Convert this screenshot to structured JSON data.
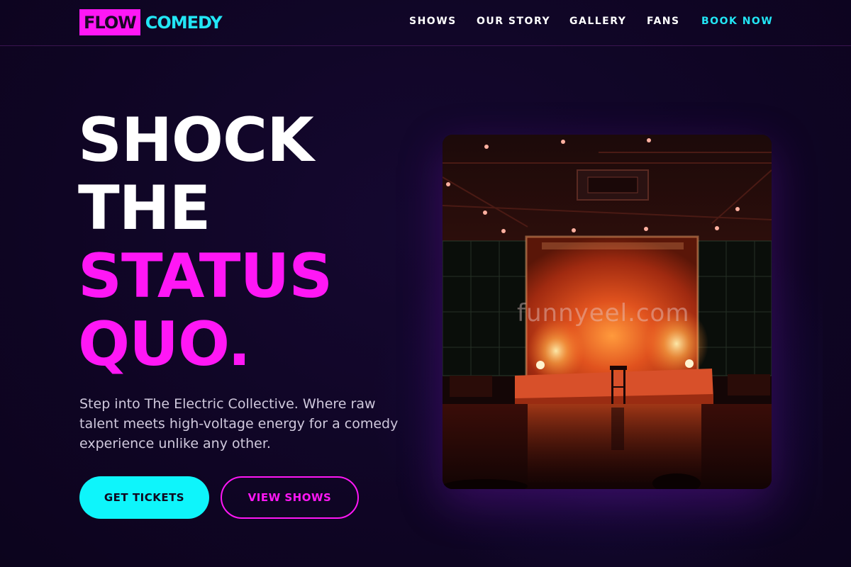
{
  "brand": {
    "box_text": "FLOW",
    "word_text": "COMEDY",
    "box_color": "#ff17f5",
    "word_color": "#22e6f5"
  },
  "nav": {
    "items": [
      {
        "label": "SHOWS"
      },
      {
        "label": "OUR STORY"
      },
      {
        "label": "GALLERY"
      },
      {
        "label": "FANS"
      },
      {
        "label": "BOOK NOW"
      }
    ]
  },
  "hero": {
    "headline": {
      "line1": "SHOCK",
      "line2": "THE",
      "line3": "STATUS",
      "line4": "QUO."
    },
    "description": "Step into The Electric Collective. Where raw talent meets high-voltage energy for a comedy experience unlike any other.",
    "primary_cta": "GET TICKETS",
    "secondary_cta": "VIEW SHOWS",
    "image": {
      "subject": "stage-photo",
      "watermark": "funnyeel.com"
    }
  },
  "colors": {
    "background": "#0f0524",
    "accent_pink": "#ff17f5",
    "accent_cyan": "#0ef5fb"
  }
}
